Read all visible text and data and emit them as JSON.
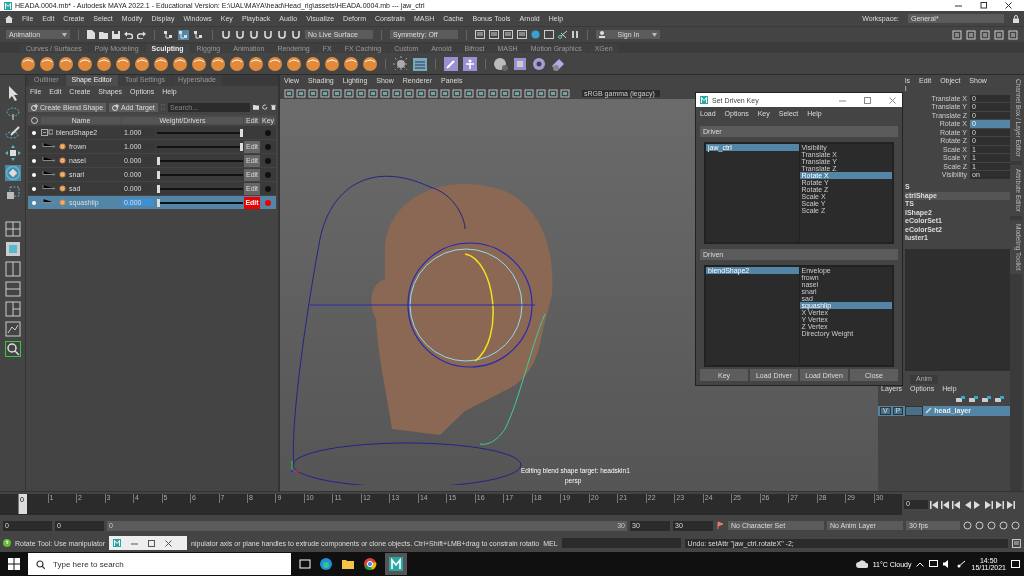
{
  "window": {
    "title": "HEADA.0004.mb* - Autodesk MAYA 2022.1 - Educational Version: E:\\UAL\\MAYA\\head\\Head_rig\\assets\\HEADA.0004.mb  ---  jaw_ctrl"
  },
  "menu_bar": {
    "items": [
      "File",
      "Edit",
      "Create",
      "Select",
      "Modify",
      "Display",
      "Windows",
      "Key",
      "Playback",
      "Audio",
      "Visualize",
      "Deform",
      "Constrain",
      "MASH",
      "Cache",
      "Bonus Tools",
      "Arnold",
      "Help"
    ],
    "workspace_label": "Workspace:",
    "workspace_value": "General*"
  },
  "status_line": {
    "menu_set": "Animation",
    "live_surface": "No Live Surface",
    "symmetry": "Symmetry: Off",
    "sign_in": "Sign In"
  },
  "shelf": {
    "tabs": [
      {
        "label": "Curves / Surfaces",
        "selected": false
      },
      {
        "label": "Poly Modeling",
        "selected": false
      },
      {
        "label": "Sculpting",
        "selected": true
      },
      {
        "label": "Rigging",
        "selected": false
      },
      {
        "label": "Animation",
        "selected": false
      },
      {
        "label": "Rendering",
        "selected": false
      },
      {
        "label": "FX",
        "selected": false
      },
      {
        "label": "FX Caching",
        "selected": false
      },
      {
        "label": "Custom",
        "selected": false
      },
      {
        "label": "Arnold",
        "selected": false
      },
      {
        "label": "Bifrost",
        "selected": false
      },
      {
        "label": "MASH",
        "selected": false
      },
      {
        "label": "Motion Graphics",
        "selected": false
      },
      {
        "label": "XGen",
        "selected": false
      }
    ]
  },
  "shape_editor": {
    "tabs": [
      {
        "label": "Outliner",
        "selected": false
      },
      {
        "label": "Shape Editor",
        "selected": true
      },
      {
        "label": "Tool Settings",
        "selected": false
      },
      {
        "label": "Hypershade",
        "selected": false
      }
    ],
    "menu": [
      "File",
      "Edit",
      "Create",
      "Shapes",
      "Options",
      "Help"
    ],
    "create_button": "Create Blend Shape",
    "add_button": "Add Target",
    "search_placeholder": "Search...",
    "columns": [
      "Name",
      "Weight/Drivers",
      "Edit",
      "Key"
    ],
    "rows": [
      {
        "kind": "group",
        "name": "blendShape2",
        "weight": "1.000",
        "level": 1,
        "selected": false,
        "keyed": false
      },
      {
        "kind": "target",
        "name": "frown",
        "weight": "1.000",
        "level": 1,
        "edit_label": "Edit",
        "selected": false,
        "editing": false,
        "keyed": false
      },
      {
        "kind": "target",
        "name": "nasel",
        "weight": "0.000",
        "level": 0,
        "edit_label": "Edit",
        "selected": false,
        "editing": false,
        "keyed": false
      },
      {
        "kind": "target",
        "name": "snarl",
        "weight": "0.000",
        "level": 0,
        "edit_label": "Edit",
        "selected": false,
        "editing": false,
        "keyed": false
      },
      {
        "kind": "target",
        "name": "sad",
        "weight": "0.000",
        "level": 0,
        "edit_label": "Edit",
        "selected": false,
        "editing": false,
        "keyed": false
      },
      {
        "kind": "target",
        "name": "squashlip",
        "weight": "0.000",
        "level": 0,
        "edit_label": "Edit",
        "selected": true,
        "editing": true,
        "keyed": true
      }
    ]
  },
  "viewport": {
    "menu": [
      "View",
      "Shading",
      "Lighting",
      "Show",
      "Renderer",
      "Panels"
    ],
    "color_space": "sRGB gamma (legacy)",
    "hud_message": "Editing blend shape target: headskin1",
    "camera": "persp"
  },
  "set_driven_key": {
    "title": "Set Driven Key",
    "menu": [
      "Load",
      "Options",
      "Key",
      "Select",
      "Help"
    ],
    "driver": {
      "label": "Driver",
      "objects": [
        {
          "name": "jaw_ctrl",
          "selected": true
        }
      ],
      "attributes": [
        {
          "name": "Visibility",
          "selected": false
        },
        {
          "name": "Translate X",
          "selected": false
        },
        {
          "name": "Translate Y",
          "selected": false
        },
        {
          "name": "Translate Z",
          "selected": false
        },
        {
          "name": "Rotate X",
          "selected": true
        },
        {
          "name": "Rotate Y",
          "selected": false
        },
        {
          "name": "Rotate Z",
          "selected": false
        },
        {
          "name": "Scale X",
          "selected": false
        },
        {
          "name": "Scale Y",
          "selected": false
        },
        {
          "name": "Scale Z",
          "selected": false
        }
      ]
    },
    "driven": {
      "label": "Driven",
      "objects": [
        {
          "name": "blendShape2",
          "selected": true
        }
      ],
      "attributes": [
        {
          "name": "Envelope",
          "selected": false
        },
        {
          "name": "frown",
          "selected": false
        },
        {
          "name": "nasel",
          "selected": false
        },
        {
          "name": "snarl",
          "selected": false
        },
        {
          "name": "sad",
          "selected": false
        },
        {
          "name": "squashlip",
          "selected": true
        },
        {
          "name": "X Vertex",
          "selected": false
        },
        {
          "name": "Y Vertex",
          "selected": false
        },
        {
          "name": "Z Vertex",
          "selected": false
        },
        {
          "name": "Directory Weight",
          "selected": false
        }
      ]
    },
    "buttons": [
      "Key",
      "Load Driver",
      "Load Driven",
      "Close"
    ]
  },
  "channel_box": {
    "menu": [
      "ls",
      "Edit",
      "Object",
      "Show"
    ],
    "object": "l",
    "attributes": [
      {
        "name": "Translate X",
        "value": "0",
        "selected": false
      },
      {
        "name": "Translate Y",
        "value": "0",
        "selected": false
      },
      {
        "name": "Translate Z",
        "value": "0",
        "selected": false
      },
      {
        "name": "Rotate X",
        "value": "0",
        "selected": true
      },
      {
        "name": "Rotate Y",
        "value": "0",
        "selected": false
      },
      {
        "name": "Rotate Z",
        "value": "0",
        "selected": false
      },
      {
        "name": "Scale X",
        "value": "1",
        "selected": false
      },
      {
        "name": "Scale Y",
        "value": "1",
        "selected": false
      },
      {
        "name": "Scale Z",
        "value": "1",
        "selected": false
      },
      {
        "name": "Visibility",
        "value": "on",
        "selected": false
      }
    ],
    "shapes": [
      {
        "name": "S",
        "selected": false
      },
      {
        "name": "ctrlShape",
        "selected": true
      },
      {
        "name": "TS",
        "selected": false
      },
      {
        "name": "lShape2",
        "selected": false
      },
      {
        "name": "eColorSet1",
        "selected": false
      },
      {
        "name": "eColorSet2",
        "selected": false
      },
      {
        "name": "luster1",
        "selected": false
      }
    ]
  },
  "layer_editor": {
    "tabs": [
      {
        "label": "Anim",
        "selected": false
      }
    ],
    "menu": [
      "Layers",
      "Options",
      "Help"
    ],
    "layers": [
      {
        "visibility": "V",
        "playback": "P",
        "name": "head_layer",
        "selected": true
      }
    ]
  },
  "side_tabs": [
    "Channel Box / Layer Editor",
    "Attribute Editor",
    "Modeling Toolkit"
  ],
  "timeline": {
    "ticks": [
      {
        "label": "0",
        "current": true
      },
      {
        "label": "1",
        "current": false
      },
      {
        "label": "2",
        "current": false
      },
      {
        "label": "3",
        "current": false
      },
      {
        "label": "4",
        "current": false
      },
      {
        "label": "5",
        "current": false
      },
      {
        "label": "6",
        "current": false
      },
      {
        "label": "7",
        "current": false
      },
      {
        "label": "8",
        "current": false
      },
      {
        "label": "9",
        "current": false
      },
      {
        "label": "10",
        "current": false
      },
      {
        "label": "11",
        "current": false
      },
      {
        "label": "12",
        "current": false
      },
      {
        "label": "13",
        "current": false
      },
      {
        "label": "14",
        "current": false
      },
      {
        "label": "15",
        "current": false
      },
      {
        "label": "16",
        "current": false
      },
      {
        "label": "17",
        "current": false
      },
      {
        "label": "18",
        "current": false
      },
      {
        "label": "19",
        "current": false
      },
      {
        "label": "20",
        "current": false
      },
      {
        "label": "21",
        "current": false
      },
      {
        "label": "22",
        "current": false
      },
      {
        "label": "23",
        "current": false
      },
      {
        "label": "24",
        "current": false
      },
      {
        "label": "25",
        "current": false
      },
      {
        "label": "26",
        "current": false
      },
      {
        "label": "27",
        "current": false
      },
      {
        "label": "28",
        "current": false
      },
      {
        "label": "29",
        "current": false
      },
      {
        "label": "30",
        "current": false
      }
    ],
    "frame_field": "0"
  },
  "range": {
    "level": 1,
    "start": "0",
    "playback_start": "0",
    "slider_start": "0",
    "slider_end": "30",
    "playback_end": "30",
    "end": "30",
    "character_set": "No Character Set",
    "anim_layer": "No Anim Layer",
    "fps": "30 fps"
  },
  "command_line": {
    "help_start": "Rotate Tool: Use manipulator",
    "help_end": "nipulator axis or plane handles to extrude components or clone objects. Ctrl+Shift+LMB+drag to constrain rotatio",
    "language": "MEL",
    "result": "Undo: setAttr \"jaw_ctrl.rotateX\" -2;"
  },
  "taskbar": {
    "search_placeholder": "Type here to search",
    "weather": "11°C  Cloudy",
    "time": "14:50",
    "date": "15/11/2021"
  }
}
